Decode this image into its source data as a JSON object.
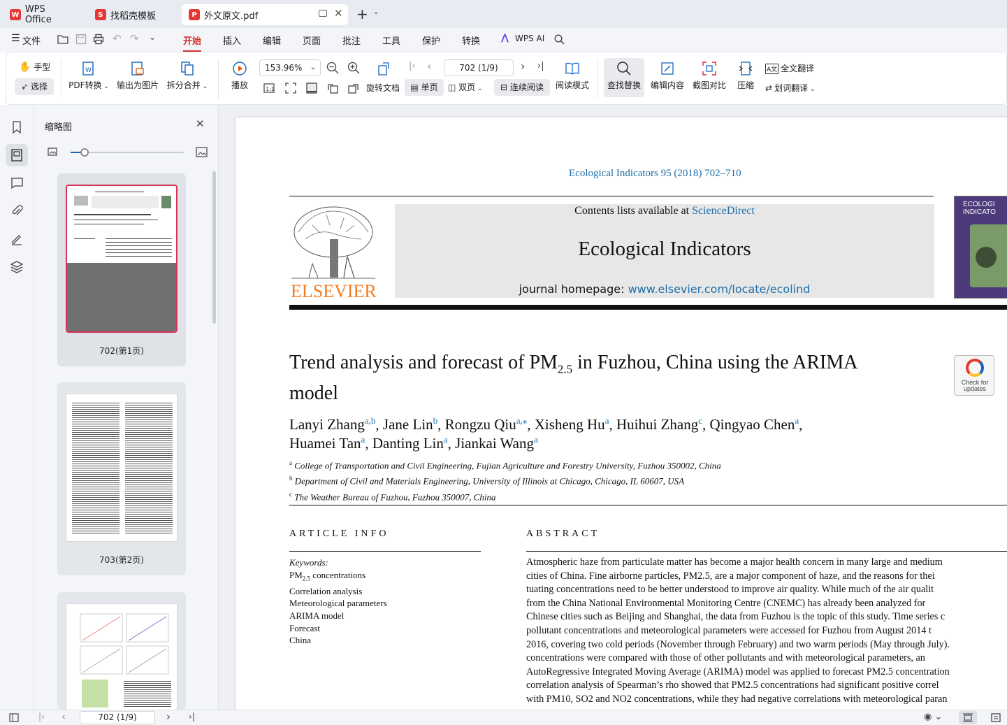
{
  "tabs": {
    "wps_office": "WPS Office",
    "templates": "找稻壳模板",
    "document": "外文原文.pdf"
  },
  "menu": {
    "file": "文件",
    "items": [
      "开始",
      "插入",
      "编辑",
      "页面",
      "批注",
      "工具",
      "保护",
      "转换"
    ],
    "wps_ai": "WPS AI"
  },
  "toolbar": {
    "hand": "手型",
    "select": "选择",
    "pdf_convert": "PDF转换",
    "export_image": "输出为图片",
    "split_merge": "拆分合并",
    "play": "播放",
    "zoom_value": "153.96%",
    "page_value": "702 (1/9)",
    "rotate_doc": "旋转文档",
    "single_page": "单页",
    "double_page": "双页",
    "continuous": "连续阅读",
    "read_mode": "阅读模式",
    "find_replace": "查找替换",
    "edit_content": "编辑内容",
    "compare": "截图对比",
    "compress": "压缩",
    "full_translate": "全文翻译",
    "word_translate": "划词翻译"
  },
  "thumbnails": {
    "title": "缩略图",
    "pages": [
      "702(第1页)",
      "703(第2页)"
    ]
  },
  "document": {
    "journal_ref": "Ecological Indicators 95 (2018) 702–710",
    "contents_prefix": "Contents lists available at ",
    "contents_link": "ScienceDirect",
    "journal_name": "Ecological Indicators",
    "homepage_prefix": "journal homepage: ",
    "homepage_url": "www.elsevier.com/locate/ecolind",
    "publisher": "ELSEVIER",
    "cover_title": "ECOLOGI INDICATO",
    "title_part1": "Trend analysis and forecast of PM",
    "title_sub": "2.5",
    "title_part2": " in Fuzhou, China using the ARIMA",
    "title_line2": "model",
    "check_updates": "Check for updates",
    "authors_line1": [
      {
        "name": "Lanyi Zhang",
        "sup": "a,b"
      },
      {
        "name": ", Jane Lin",
        "sup": "b"
      },
      {
        "name": ", Rongzu Qiu",
        "sup": "a,⁎"
      },
      {
        "name": ", Xisheng Hu",
        "sup": "a"
      },
      {
        "name": ", Huihui Zhang",
        "sup": "c"
      },
      {
        "name": ", Qingyao Chen",
        "sup": "a"
      }
    ],
    "authors_line1_end": ",",
    "authors_line2": [
      {
        "name": "Huamei Tan",
        "sup": "a"
      },
      {
        "name": ", Danting Lin",
        "sup": "a"
      },
      {
        "name": ", Jiankai Wang",
        "sup": "a"
      }
    ],
    "affiliations": [
      {
        "sup": "a",
        "text": "College of Transportation and Civil Engineering, Fujian Agriculture and Forestry University, Fuzhou 350002, China"
      },
      {
        "sup": "b",
        "text": "Department of Civil and Materials Engineering, University of Illinois at Chicago, Chicago, IL 60607, USA"
      },
      {
        "sup": "c",
        "text": "The Weather Bureau of Fuzhou, Fuzhou 350007, China"
      }
    ],
    "article_info_heading": "ARTICLE INFO",
    "abstract_heading": "ABSTRACT",
    "keywords_label": "Keywords:",
    "keywords": [
      "concentrations",
      "Correlation analysis",
      "Meteorological parameters",
      "ARIMA model",
      "Forecast",
      "China"
    ],
    "abstract_lines": [
      "Atmospheric haze from particulate matter has become a major health concern in many large and medium",
      "cities of China. Fine airborne particles, PM2.5, are a major component of haze, and the reasons for thei",
      "tuating concentrations need to be better understood to improve air quality. While much of the air qualit",
      "from the China National Environmental Monitoring Centre (CNEMC) has already been analyzed for",
      "Chinese cities such as Beijing and Shanghai, the data from Fuzhou is the topic of this study. Time series c",
      "pollutant concentrations and meteorological parameters were accessed for Fuzhou from August 2014 t",
      "2016, covering two cold periods (November through February) and two warm periods (May through July).",
      "concentrations were compared with those of other pollutants and with meteorological parameters, an",
      "AutoRegressive Integrated Moving Average (ARIMA) model was applied to forecast PM2.5 concentration",
      "correlation analysis of Spearman’s rho showed that PM2.5 concentrations had significant positive correl",
      "with PM10, SO2 and NO2 concentrations, while they had negative correlations with meteorological paran"
    ]
  },
  "status": {
    "page_value": "702 (1/9)"
  }
}
